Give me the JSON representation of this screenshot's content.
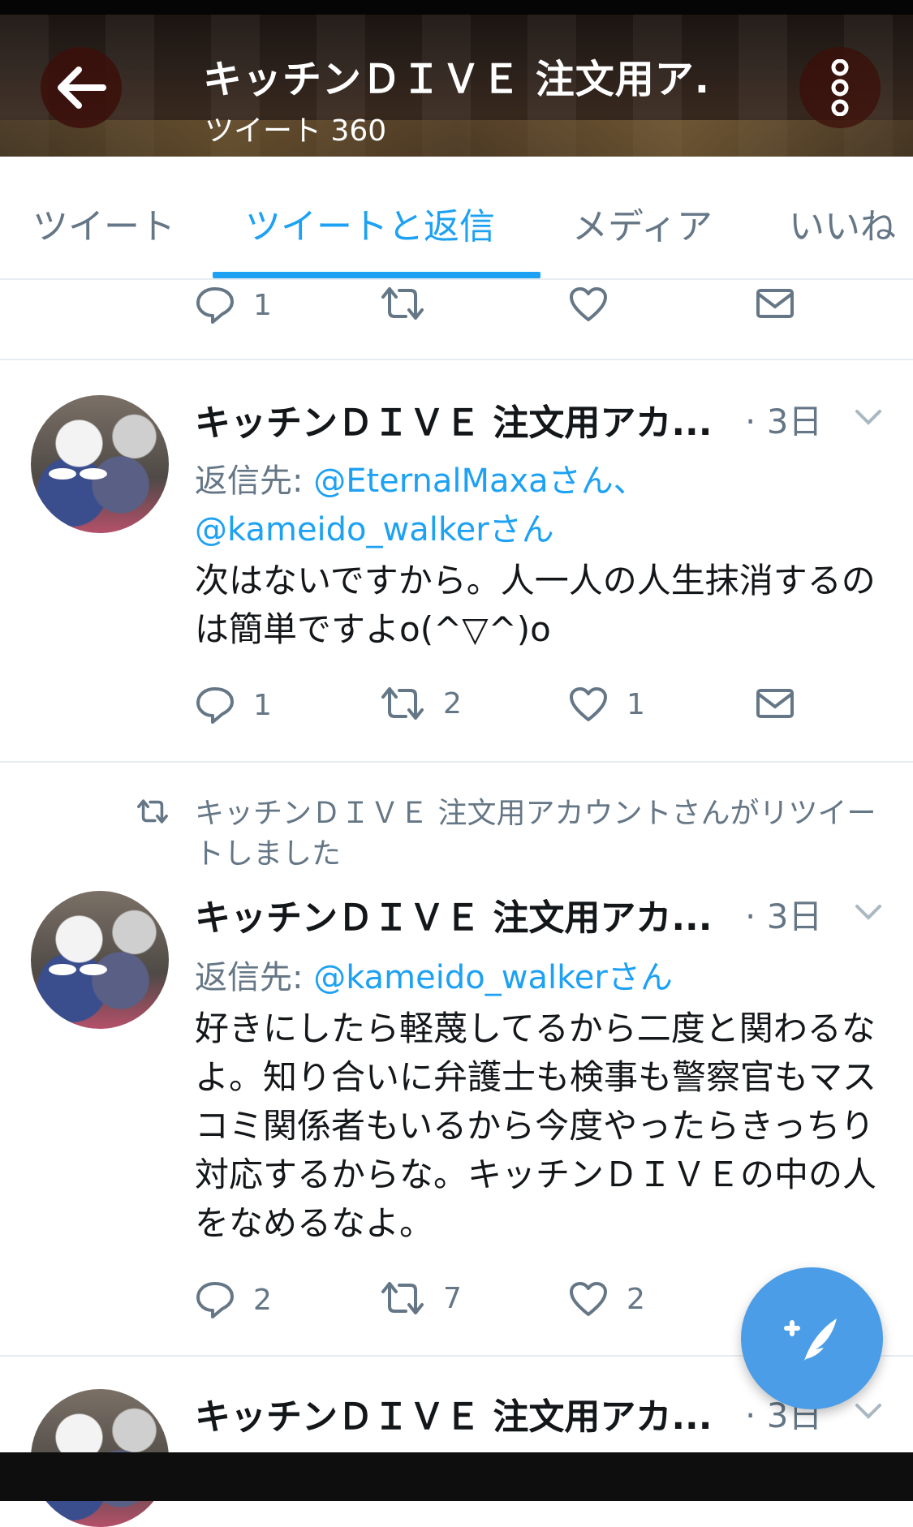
{
  "header": {
    "title": "キッチンＤＩＶＥ 注文用ア.",
    "subtitle": "ツイート 360"
  },
  "tabs": [
    {
      "label": "ツイート"
    },
    {
      "label": "ツイートと返信"
    },
    {
      "label": "メディア"
    },
    {
      "label": "いいね"
    }
  ],
  "active_tab": "ツイートと返信",
  "tweet0": {
    "reply_count": "1",
    "retweet_count": "",
    "like_count": ""
  },
  "tweet1": {
    "name": "キッチンＤＩＶＥ 注文用アカ...",
    "time": "· 3日",
    "reply_prefix": "返信先: ",
    "mention1": "@EternalMaxaさん、",
    "mention2": "@kameido_walkerさん",
    "body": "次はないですから。人一人の人生抹消するのは簡単ですよo(^▽^)o",
    "reply_count": "1",
    "retweet_count": "2",
    "like_count": "1"
  },
  "tweet2": {
    "retweeted_by": "キッチンＤＩＶＥ 注文用アカウントさんがリツイートしました",
    "name": "キッチンＤＩＶＥ 注文用アカ...",
    "time": "· 3日",
    "reply_prefix": "返信先: ",
    "mention1": "@kameido_walkerさん",
    "body": "好きにしたら軽蔑してるから二度と関わるなよ。知り合いに弁護士も検事も警察官もマスコミ関係者もいるから今度やったらきっちり対応するからな。キッチンＤＩＶＥの中の人をなめるなよ。",
    "reply_count": "2",
    "retweet_count": "7",
    "like_count": "2"
  },
  "tweet3": {
    "name": "キッチンＤＩＶＥ 注文用アカ...",
    "time": "· 3日"
  },
  "icons": {
    "back": "arrow-left-icon",
    "menu": "vertical-dots-icon",
    "reply": "reply-bubble-icon",
    "retweet": "retweet-icon",
    "like": "heart-icon",
    "dm": "envelope-icon",
    "caret": "chevron-down-icon",
    "compose": "compose-feather-icon"
  },
  "colors": {
    "accent": "#1da1f2",
    "muted": "#657786",
    "fab": "#4a9de6"
  }
}
